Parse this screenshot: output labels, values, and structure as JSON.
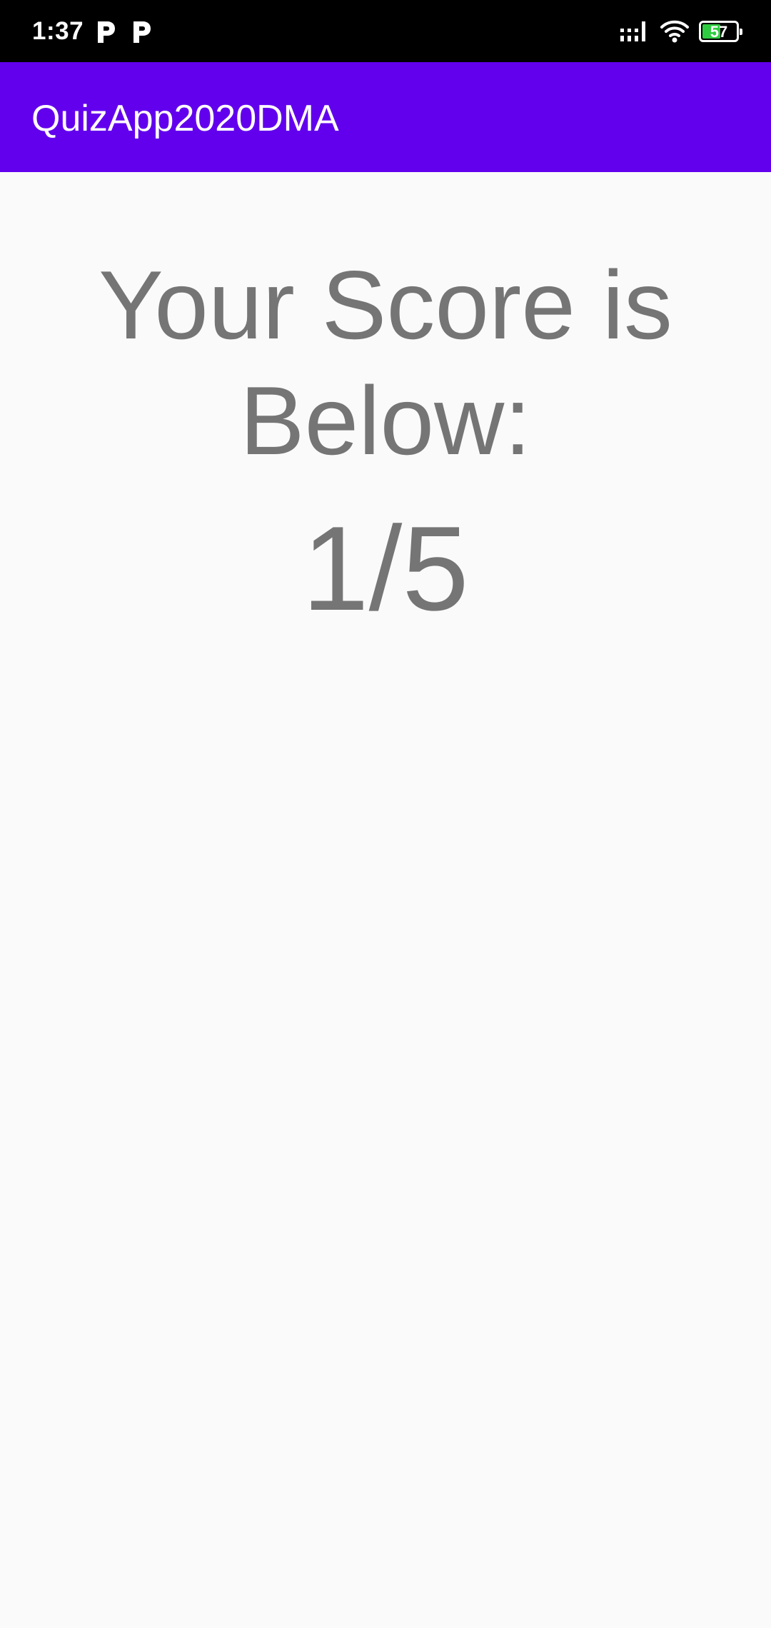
{
  "status_bar": {
    "time": "1:37",
    "battery_level": "57",
    "battery_fraction": 0.57,
    "battery_fill_color": "#2ecc40",
    "notification_icons": [
      "parking-icon",
      "parking-icon"
    ],
    "status_icons": [
      "signal-icon",
      "wifi-icon",
      "battery-icon"
    ]
  },
  "app_bar": {
    "title": "QuizApp2020DMA",
    "color": "#6200ee"
  },
  "main": {
    "score_heading": "Your Score is Below:",
    "score_value": "1/5",
    "text_color": "#757575",
    "background": "#fafafa"
  }
}
